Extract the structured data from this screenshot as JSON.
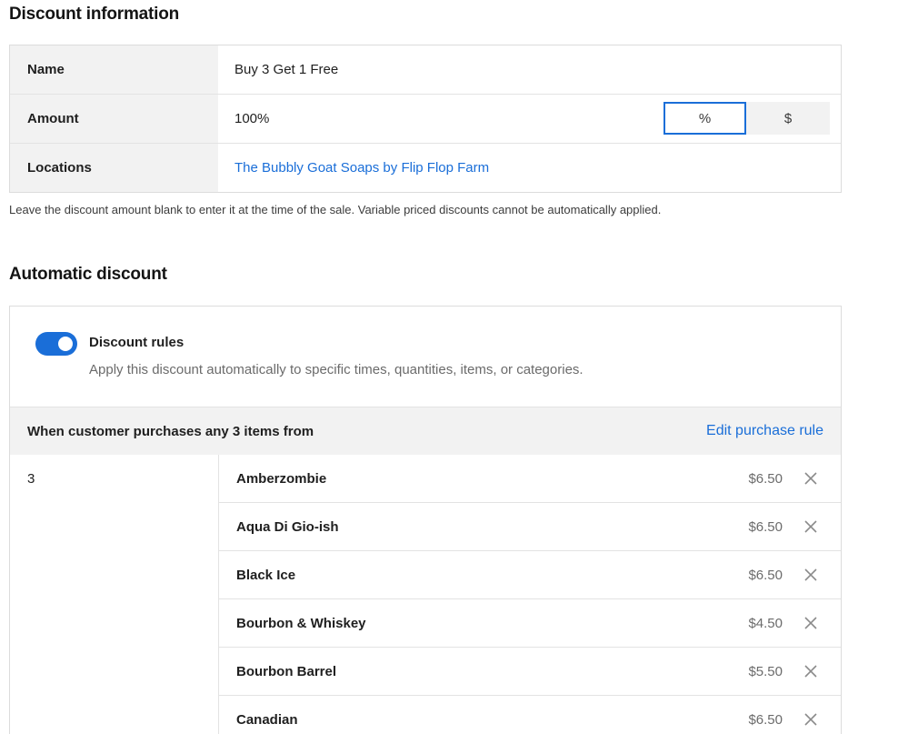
{
  "discount_info": {
    "heading": "Discount information",
    "rows": {
      "name": {
        "label": "Name",
        "value": "Buy 3 Get 1 Free"
      },
      "amount": {
        "label": "Amount",
        "value": "100%",
        "percent_option": "%",
        "dollar_option": "$"
      },
      "locations": {
        "label": "Locations",
        "value": "The Bubbly Goat Soaps by Flip Flop Farm"
      }
    },
    "help_text": "Leave the discount amount blank to enter it at the time of the sale. Variable priced discounts cannot be automatically applied."
  },
  "automatic_discount": {
    "heading": "Automatic discount",
    "toggle": {
      "on": true
    },
    "rules_title": "Discount rules",
    "rules_desc": "Apply this discount automatically to specific times, quantities, items, or categories.",
    "purchase_rule_title": "When customer purchases any 3 items from",
    "edit_purchase_rule": "Edit purchase rule",
    "quantity": "3",
    "items": [
      {
        "name": "Amberzombie",
        "price": "$6.50"
      },
      {
        "name": "Aqua Di Gio-ish",
        "price": "$6.50"
      },
      {
        "name": "Black Ice",
        "price": "$6.50"
      },
      {
        "name": "Bourbon & Whiskey",
        "price": "$4.50"
      },
      {
        "name": "Bourbon Barrel",
        "price": "$5.50"
      },
      {
        "name": "Canadian",
        "price": "$6.50"
      }
    ]
  },
  "colors": {
    "accent": "#1a6ed8",
    "label_bg": "#f2f2f2",
    "border": "#dcdcdc"
  },
  "icons": {
    "remove": "close-icon"
  }
}
